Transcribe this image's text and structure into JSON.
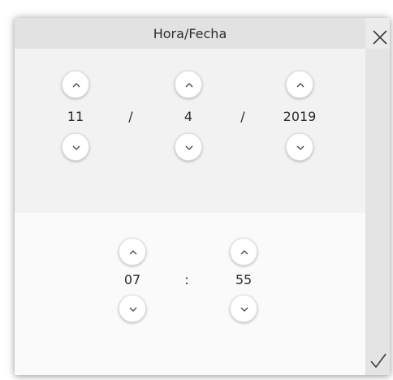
{
  "dialog": {
    "title": "Hora/Fecha",
    "close_icon": "close-icon",
    "confirm_icon": "checkmark-icon"
  },
  "date": {
    "day": "11",
    "month": "4",
    "year": "2019",
    "separator": "/"
  },
  "time": {
    "hour": "07",
    "minute": "55",
    "separator": ":"
  },
  "icons": {
    "increment": "chevron-up-icon",
    "decrement": "chevron-down-icon"
  }
}
